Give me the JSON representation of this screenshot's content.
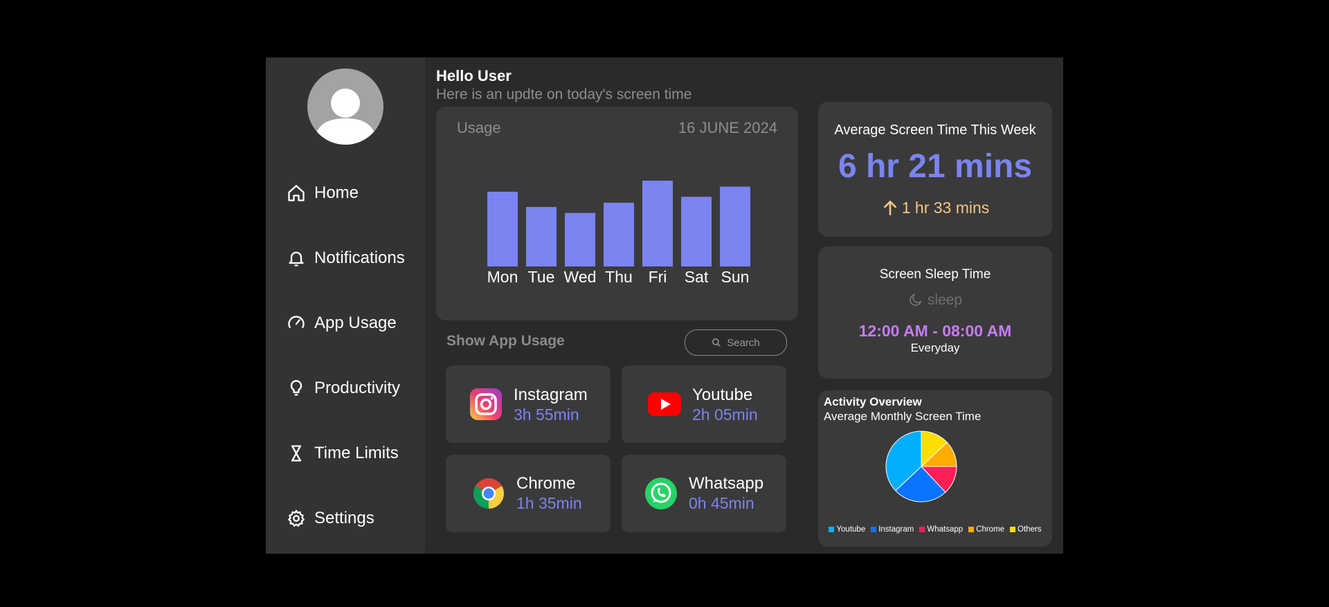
{
  "sidebar": {
    "items": [
      {
        "label": "Home",
        "icon": "home-icon"
      },
      {
        "label": "Notifications",
        "icon": "bell-icon"
      },
      {
        "label": "App Usage",
        "icon": "gauge-icon"
      },
      {
        "label": "Productivity",
        "icon": "lightbulb-icon"
      },
      {
        "label": "Time Limits",
        "icon": "hourglass-icon"
      },
      {
        "label": "Settings",
        "icon": "gear-icon"
      }
    ]
  },
  "header": {
    "title": "Hello User",
    "subtitle": "Here is an updte on today's screen time"
  },
  "usage": {
    "label": "Usage",
    "date": "16 JUNE 2024"
  },
  "chart_data": {
    "type": "bar",
    "categories": [
      "Mon",
      "Tue",
      "Wed",
      "Thu",
      "Fri",
      "Sat",
      "Sun"
    ],
    "values": [
      88,
      70,
      63,
      75,
      101,
      82,
      94
    ],
    "ylim": [
      0,
      101
    ],
    "color": "#7b84f0"
  },
  "app_usage": {
    "title": "Show App Usage",
    "search_placeholder": "Search",
    "apps": [
      {
        "name": "Instagram",
        "time": "3h 55min",
        "icon": "instagram-icon"
      },
      {
        "name": "Youtube",
        "time": "2h 05min",
        "icon": "youtube-icon"
      },
      {
        "name": "Chrome",
        "time": "1h 35min",
        "icon": "chrome-icon"
      },
      {
        "name": "Whatsapp",
        "time": "0h 45min",
        "icon": "whatsapp-icon"
      }
    ]
  },
  "avg_screen_time": {
    "title": "Average Screen Time This Week",
    "value": "6 hr 21 mins",
    "delta": "1 hr 33 mins",
    "delta_direction": "up"
  },
  "sleep": {
    "title": "Screen Sleep Time",
    "state": "sleep",
    "range": "12:00 AM - 08:00 AM",
    "repeat": "Everyday"
  },
  "activity": {
    "title": "Activity Overview",
    "subtitle": "Average Monthly Screen Time",
    "pie": {
      "type": "pie",
      "slices": [
        {
          "label": "Youtube",
          "value": 37,
          "color": "#00b0ff"
        },
        {
          "label": "Instagram",
          "value": 25,
          "color": "#0a74ff"
        },
        {
          "label": "Whatsapp",
          "value": 13,
          "color": "#ff1f55"
        },
        {
          "label": "Chrome",
          "value": 12,
          "color": "#ffad00"
        },
        {
          "label": "Others",
          "value": 13,
          "color": "#ffdd00"
        }
      ]
    }
  },
  "colors": {
    "accent": "#7b84f0",
    "delta": "#f7c485",
    "sleep_range": "#c67cf5"
  }
}
